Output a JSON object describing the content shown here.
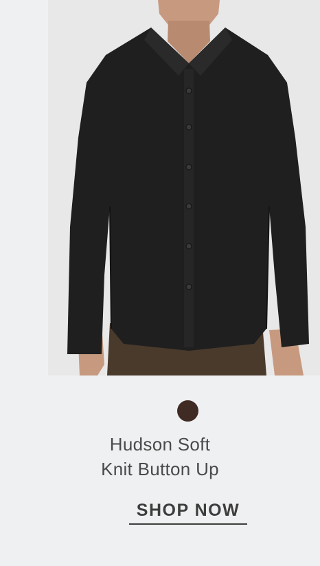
{
  "product": {
    "name_line1": "Hudson Soft",
    "name_line2": "Knit Button Up",
    "swatch": {
      "color": "#3f2b24",
      "icon": "color-swatch-circle"
    }
  },
  "cta": {
    "label": "SHOP NOW"
  },
  "colors": {
    "background": "#eff0f2",
    "photo_bg": "#e8e8e8",
    "shirt": "#1f1f1f",
    "pants": "#4a3a2c",
    "skin": "#c79a80",
    "text": "#4a4a4a"
  }
}
